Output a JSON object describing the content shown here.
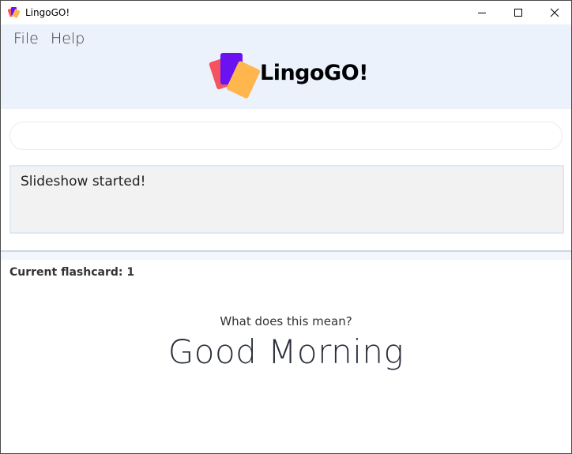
{
  "window": {
    "title": "LingoGO!"
  },
  "menu": {
    "file": "File",
    "help": "Help"
  },
  "logo": {
    "text": "LingoGO!",
    "colors": [
      "#f4535f",
      "#6a12f0",
      "#ffb64d"
    ]
  },
  "command": {
    "value": "",
    "placeholder": ""
  },
  "result": {
    "message": "Slideshow started!"
  },
  "flashcard": {
    "current_label": "Current flashcard: 1",
    "question": "What does this mean?",
    "word": "Good Morning"
  },
  "colors": {
    "header_bg": "#ebf2fc",
    "result_bg": "#f2f2f2"
  }
}
